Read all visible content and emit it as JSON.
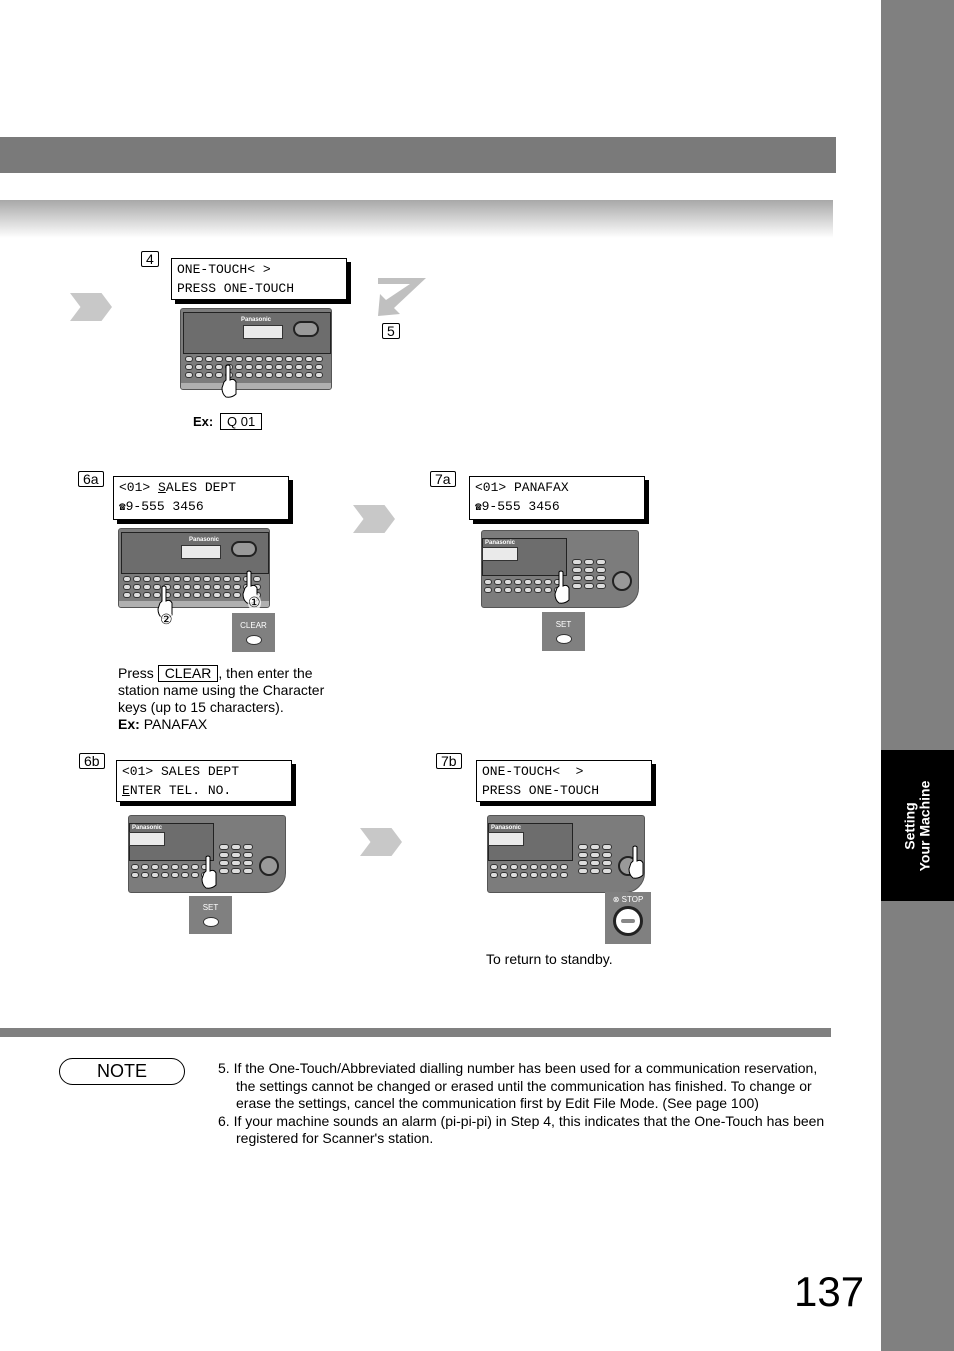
{
  "side_tab": {
    "line1": "Setting",
    "line2": "Your Machine"
  },
  "steps": {
    "s4": {
      "num": "4",
      "lcd": [
        "ONE-TOUCH< >",
        "PRESS ONE-TOUCH"
      ],
      "example_label": "Ex:",
      "example_value": "Q 01"
    },
    "s5": {
      "num": "5"
    },
    "s6a": {
      "num": "6a",
      "lcd_prefix": "<01> ",
      "lcd_underlined": "S",
      "lcd_rest": "ALES DEPT",
      "phone_icon": "☎",
      "lcd2": "9-555 3456",
      "button": "CLEAR",
      "marker1": "①",
      "marker2": "②",
      "instruction": {
        "press": "Press",
        "key": "CLEAR",
        "after": ", then enter the station name using the Character keys (up to 15 characters).",
        "ex_label": "Ex:",
        "ex_value": "PANAFAX"
      }
    },
    "s7a": {
      "num": "7a",
      "lcd1": "<01> PANAFAX",
      "phone_icon": "☎",
      "lcd2": "9-555 3456",
      "button": "SET"
    },
    "s6b": {
      "num": "6b",
      "lcd1": "<01> SALES DEPT",
      "lcd2_underlined": "E",
      "lcd2_rest": "NTER TEL. NO.",
      "button": "SET"
    },
    "s7b": {
      "num": "7b",
      "lcd": [
        "ONE-TOUCH<  >",
        "PRESS ONE-TOUCH"
      ],
      "button": "STOP",
      "caption": "To return to standby."
    }
  },
  "panel_brand": "Panasonic",
  "note": {
    "label": "NOTE",
    "items": [
      "5.  If the One-Touch/Abbreviated dialling number has been used for a communication reservation, the settings cannot be changed or erased until the communication has finished. To change or erase the settings, cancel the communication first by Edit File Mode. (See page 100)",
      "6.  If your machine sounds an alarm (pi-pi-pi) in Step 4, this indicates that the One-Touch has been registered for Scanner's station."
    ]
  },
  "page_number": "137"
}
